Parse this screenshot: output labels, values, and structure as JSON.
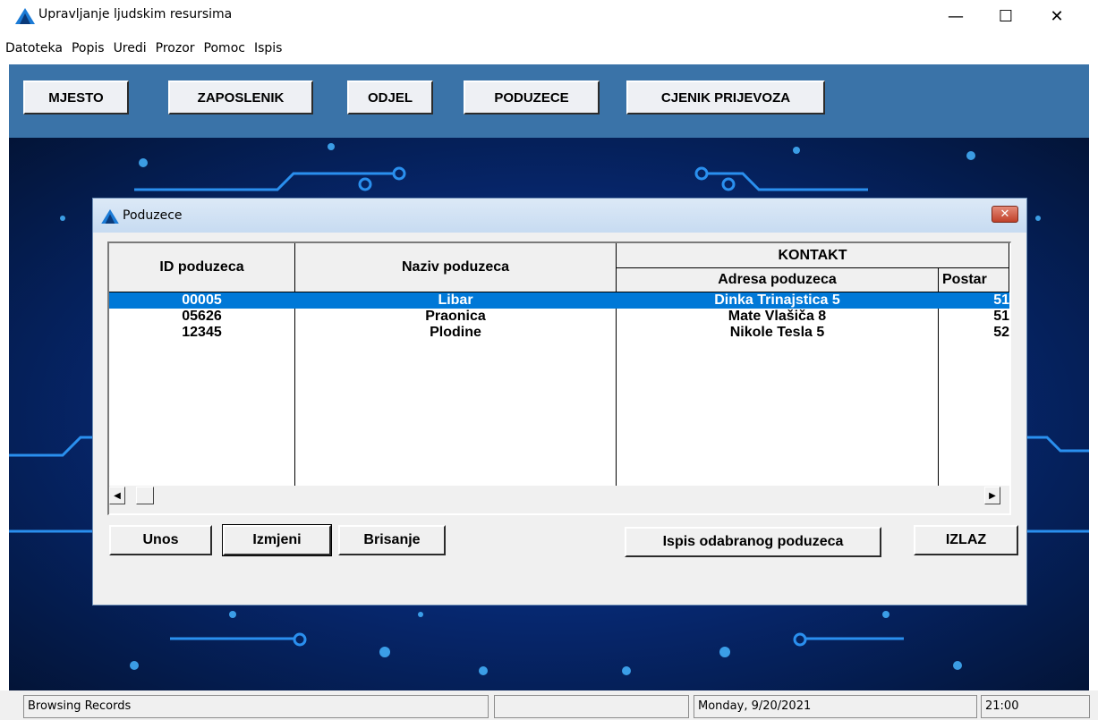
{
  "window": {
    "title": "Upravljanje ljudskim resursima",
    "minimize_glyph": "—",
    "maximize_glyph": "☐",
    "close_glyph": "✕",
    "icon": "app-triangle-icon"
  },
  "menu": [
    "Datoteka",
    "Popis",
    "Uredi",
    "Prozor",
    "Pomoc",
    "Ispis"
  ],
  "toolbar": {
    "buttons": [
      "MJESTO",
      "ZAPOSLENIK",
      "ODJEL",
      "PODUZECE",
      "CJENIK PRIJEVOZA"
    ]
  },
  "dialog": {
    "title": "Poduzece",
    "close_glyph": "✕",
    "grid": {
      "headers": {
        "id": "ID poduzeca",
        "naziv": "Naziv poduzeca",
        "kontakt": "KONTAKT",
        "adresa": "Adresa poduzeca",
        "postar": "Postar"
      },
      "rows": [
        {
          "id": "00005",
          "naziv": "Libar",
          "adresa": "Dinka Trinajstica 5",
          "postar": "51",
          "selected": true
        },
        {
          "id": "05626",
          "naziv": "Praonica",
          "adresa": "Mate Vlašiča 8",
          "postar": "51",
          "selected": false
        },
        {
          "id": "12345",
          "naziv": "Plodine",
          "adresa": "Nikole Tesla 5",
          "postar": "52",
          "selected": false
        }
      ],
      "scroll_left": "◀",
      "scroll_right": "▶"
    },
    "buttons": {
      "unos": "Unos",
      "izmjeni": "Izmjeni",
      "brisanje": "Brisanje",
      "ispis": "Ispis odabranog poduzeca",
      "izlaz": "IZLAZ"
    }
  },
  "statusbar": {
    "status": "Browsing Records",
    "date": "Monday,  9/20/2021",
    "time": "21:00"
  },
  "colors": {
    "toolbar": "#3a73a8",
    "selection": "#0078d7",
    "desktop": "#06266b",
    "icon_blue": "#1b7bd6"
  }
}
